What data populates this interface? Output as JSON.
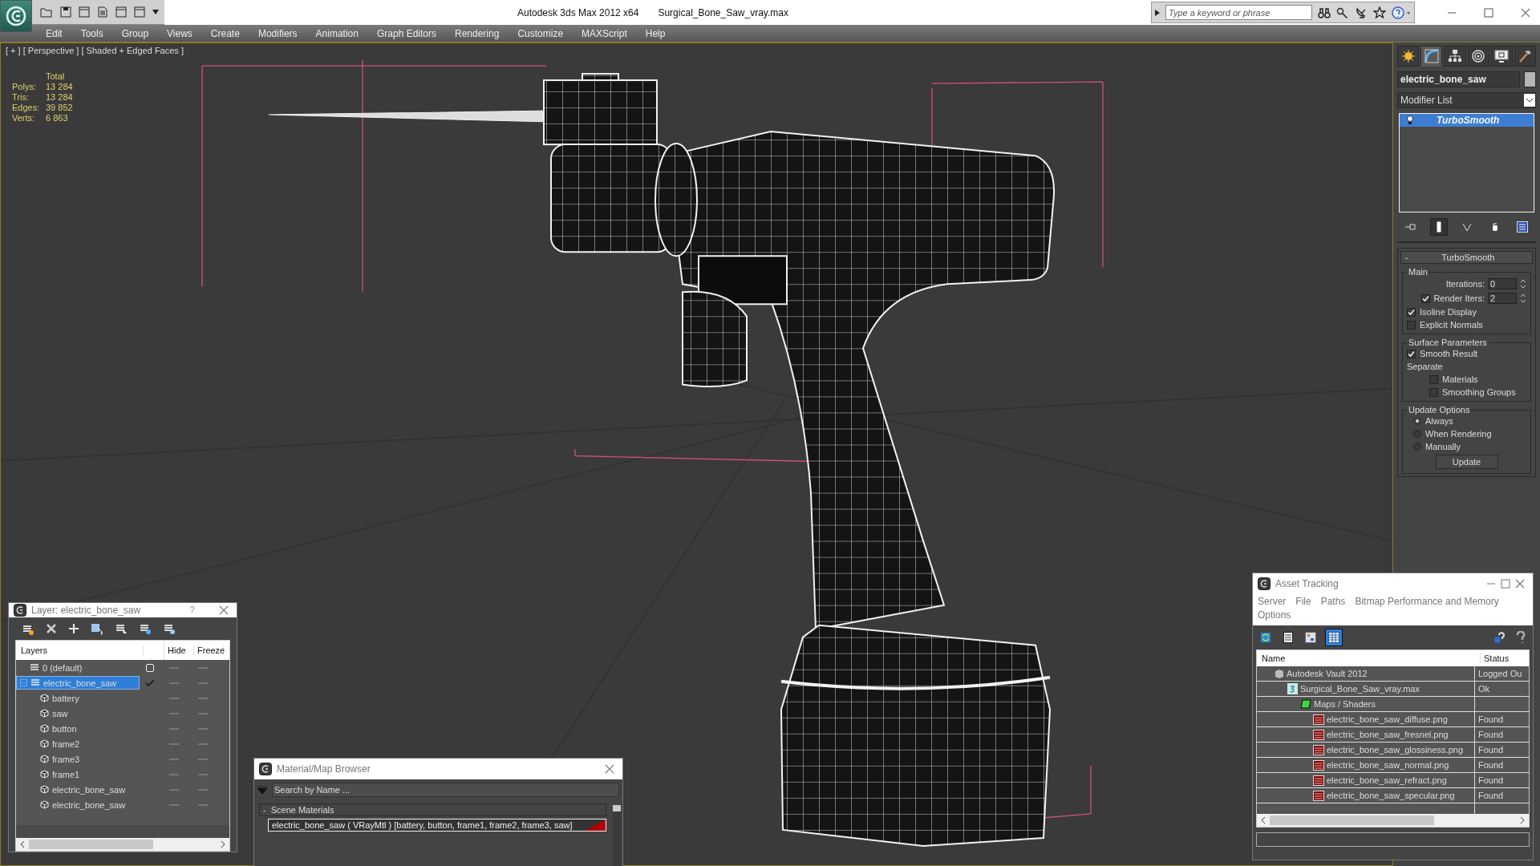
{
  "title_bar": {
    "app_title": "Autodesk 3ds Max  2012 x64",
    "file_name": "Surgical_Bone_Saw_vray.max",
    "search": {
      "placeholder": "Type a keyword or phrase"
    }
  },
  "menu": [
    "Edit",
    "Tools",
    "Group",
    "Views",
    "Create",
    "Modifiers",
    "Animation",
    "Graph Editors",
    "Rendering",
    "Customize",
    "MAXScript",
    "Help"
  ],
  "viewport": {
    "label": "[ + ] [ Perspective ] [ Shaded + Edged Faces ]",
    "stats": {
      "header": "Total",
      "rows": [
        {
          "label": "Polys:",
          "value": "13 284"
        },
        {
          "label": "Tris:",
          "value": "13 284"
        },
        {
          "label": "Edges:",
          "value": "39 852"
        },
        {
          "label": "Verts:",
          "value": "6 863"
        }
      ]
    }
  },
  "command_panel": {
    "tabs": [
      {
        "kind": "create",
        "selected": false
      },
      {
        "kind": "modify",
        "selected": true
      },
      {
        "kind": "hierarchy",
        "selected": false
      },
      {
        "kind": "motion",
        "selected": false
      },
      {
        "kind": "display",
        "selected": false
      },
      {
        "kind": "utilities",
        "selected": false
      }
    ],
    "object_name": "electric_bone_saw",
    "modifier_list": "Modifier List",
    "stack": [
      {
        "label": "TurboSmooth",
        "selected": true
      }
    ],
    "stack_tools": [
      {
        "kind": "pin",
        "selected": false
      },
      {
        "kind": "end_result",
        "selected": true
      },
      {
        "kind": "unique",
        "selected": false
      },
      {
        "kind": "remove",
        "selected": false
      },
      {
        "kind": "configure",
        "selected": false
      }
    ],
    "rollout": {
      "toggle": "-",
      "title": "TurboSmooth",
      "groups": [
        {
          "label": "Main",
          "items": [
            {
              "kind": "spinner",
              "label": "Iterations:",
              "value": "0"
            },
            {
              "kind": "check_spinner",
              "label": "Render Iters:",
              "checked": true,
              "value": "2"
            },
            {
              "kind": "checkbox",
              "label": "Isoline Display",
              "checked": true
            },
            {
              "kind": "checkbox",
              "label": "Explicit Normals",
              "checked": false
            }
          ]
        },
        {
          "label": "Surface Parameters",
          "items": [
            {
              "kind": "checkbox",
              "label": "Smooth Result",
              "checked": true
            },
            {
              "kind": "text",
              "label": "Separate"
            },
            {
              "kind": "subcheckbox",
              "label": "Materials",
              "checked": false
            },
            {
              "kind": "subcheckbox",
              "label": "Smoothing Groups",
              "checked": false
            }
          ]
        },
        {
          "label": "Update Options",
          "items": [
            {
              "kind": "radio",
              "label": "Always",
              "selected": true
            },
            {
              "kind": "radio",
              "label": "When Rendering",
              "selected": false
            },
            {
              "kind": "radio",
              "label": "Manually",
              "selected": false
            },
            {
              "kind": "button",
              "label": "Update"
            }
          ]
        }
      ]
    }
  },
  "layer_window": {
    "title": "Layer: electric_bone_saw",
    "help": "?",
    "columns": [
      "Layers",
      "Hide",
      "Freeze"
    ],
    "layers": [
      {
        "name": "0 (default)",
        "current": false,
        "selected": false
      },
      {
        "name": "electric_bone_saw",
        "current": true,
        "selected": true,
        "expanded": true,
        "children": [
          {
            "name": "battery"
          },
          {
            "name": "saw"
          },
          {
            "name": "button"
          },
          {
            "name": "frame2"
          },
          {
            "name": "frame3"
          },
          {
            "name": "frame1"
          },
          {
            "name": "electric_bone_saw"
          },
          {
            "name": "electric_bone_saw"
          }
        ]
      }
    ]
  },
  "material_browser": {
    "title": "Material/Map Browser",
    "search": {
      "placeholder": "Search by Name ..."
    },
    "groups": [
      {
        "toggle": "-",
        "label": "Scene Materials",
        "materials": [
          {
            "label": "electric_bone_saw  ( VRayMtl )  [battery, button, frame1, frame2, frame3, saw]",
            "selected": true
          }
        ]
      }
    ]
  },
  "asset_tracking": {
    "title": "Asset Tracking",
    "menu": [
      "Server",
      "File",
      "Paths",
      "Bitmap Performance and Memory",
      "Options"
    ],
    "view_buttons": [
      {
        "kind": "refresh",
        "selected": false
      },
      {
        "kind": "list",
        "selected": false
      },
      {
        "kind": "tree",
        "selected": false
      },
      {
        "kind": "table",
        "selected": true
      }
    ],
    "columns": [
      "Name",
      "Status"
    ],
    "assets": [
      {
        "kind": "vault",
        "name": "Autodesk Vault 2012",
        "status": "Logged Ou",
        "children": [
          {
            "kind": "scene",
            "name": "Surgical_Bone_Saw_vray.max",
            "status": "Ok",
            "children": [
              {
                "kind": "folder",
                "name": "Maps / Shaders",
                "children": [
                  {
                    "kind": "png",
                    "name": "electric_bone_saw_diffuse.png",
                    "status": "Found"
                  },
                  {
                    "kind": "png",
                    "name": "electric_bone_saw_fresnel.png",
                    "status": "Found"
                  },
                  {
                    "kind": "png",
                    "name": "electric_bone_saw_glossiness.png",
                    "status": "Found"
                  },
                  {
                    "kind": "png",
                    "name": "electric_bone_saw_normal.png",
                    "status": "Found"
                  },
                  {
                    "kind": "png",
                    "name": "electric_bone_saw_refract.png",
                    "status": "Found"
                  },
                  {
                    "kind": "png",
                    "name": "electric_bone_saw_specular.png",
                    "status": "Found"
                  }
                ]
              }
            ]
          }
        ]
      }
    ]
  }
}
